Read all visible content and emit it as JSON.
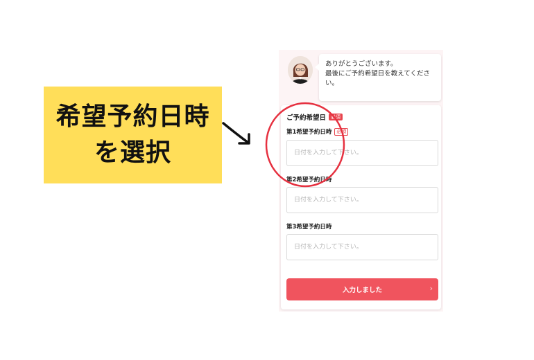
{
  "callout": {
    "line1": "希望予約日時",
    "line2": "を選択",
    "background": "#ffde59"
  },
  "chat": {
    "avatar_icon": "operator-avatar-icon",
    "message": "ありがとうございます。\n最後にご予約希望日を教えてください。"
  },
  "form": {
    "section_title": "ご予約希望日",
    "required_badge": "必須",
    "fields": [
      {
        "label": "第1希望予約日時",
        "required_badge": "必須",
        "placeholder": "日付を入力して下さい。",
        "value": ""
      },
      {
        "label": "第2希望予約日時",
        "placeholder": "日付を入力して下さい。",
        "value": ""
      },
      {
        "label": "第3希望予約日時",
        "placeholder": "日付を入力して下さい。",
        "value": ""
      }
    ],
    "submit_label": "入力しました",
    "submit_icon": "chevron-right-icon",
    "accent_color": "#f0545e"
  },
  "annotation": {
    "highlight_color": "#e63140",
    "arrow_icon": "arrow-right-icon"
  }
}
